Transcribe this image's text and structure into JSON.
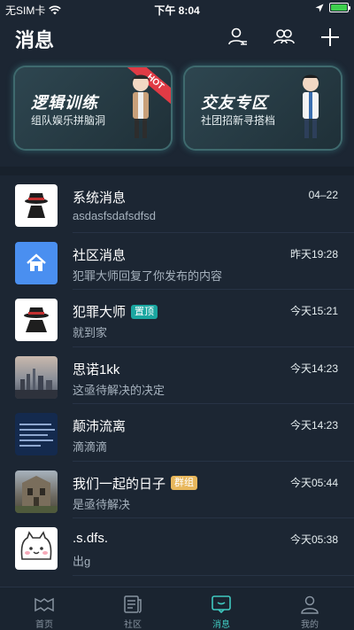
{
  "status_bar": {
    "carrier": "无SIM卡",
    "time": "下午 8:04"
  },
  "header": {
    "title": "消息"
  },
  "cards": [
    {
      "title": "逻辑训练",
      "subtitle": "组队娱乐拼脑洞",
      "ribbon": "HOT"
    },
    {
      "title": "交友专区",
      "subtitle": "社团招新寻搭档"
    }
  ],
  "messages": [
    {
      "name": "系统消息",
      "preview": "asdasfsdafsdfsd",
      "time": "04–22",
      "badge": "",
      "avatar": "spy-avatar"
    },
    {
      "name": "社区消息",
      "preview": "犯罪大师回复了你发布的内容",
      "time": "昨天19:28",
      "badge": "",
      "avatar": "home-avatar"
    },
    {
      "name": "犯罪大师",
      "preview": "就到家",
      "time": "今天15:21",
      "badge": "置顶",
      "avatar": "spy-avatar"
    },
    {
      "name": "思诺1kk",
      "preview": "这亟待解决的决定",
      "time": "今天14:23",
      "badge": "",
      "avatar": "city-photo"
    },
    {
      "name": "颠沛流离",
      "preview": "滴滴滴",
      "time": "今天14:23",
      "badge": "",
      "avatar": "text-screenshot"
    },
    {
      "name": "我们一起的日子",
      "preview": "是亟待解决",
      "time": "今天05:44",
      "badge": "群组",
      "avatar": "street-photo"
    },
    {
      "name": ".s.dfs.",
      "preview": "出g",
      "time": "今天05:38",
      "badge": "",
      "avatar": "cat-cartoon"
    }
  ],
  "tabs": [
    {
      "label": "首页",
      "icon": "home-icon",
      "active": false
    },
    {
      "label": "社区",
      "icon": "community-icon",
      "active": false
    },
    {
      "label": "消息",
      "icon": "message-icon",
      "active": true
    },
    {
      "label": "我的",
      "icon": "profile-icon",
      "active": false
    }
  ],
  "colors": {
    "background": "#1c2633",
    "accent": "#3fc9c0",
    "pin_badge": "#1aa6a0",
    "group_badge": "#e8b75c",
    "hot_ribbon": "#e03b45"
  }
}
